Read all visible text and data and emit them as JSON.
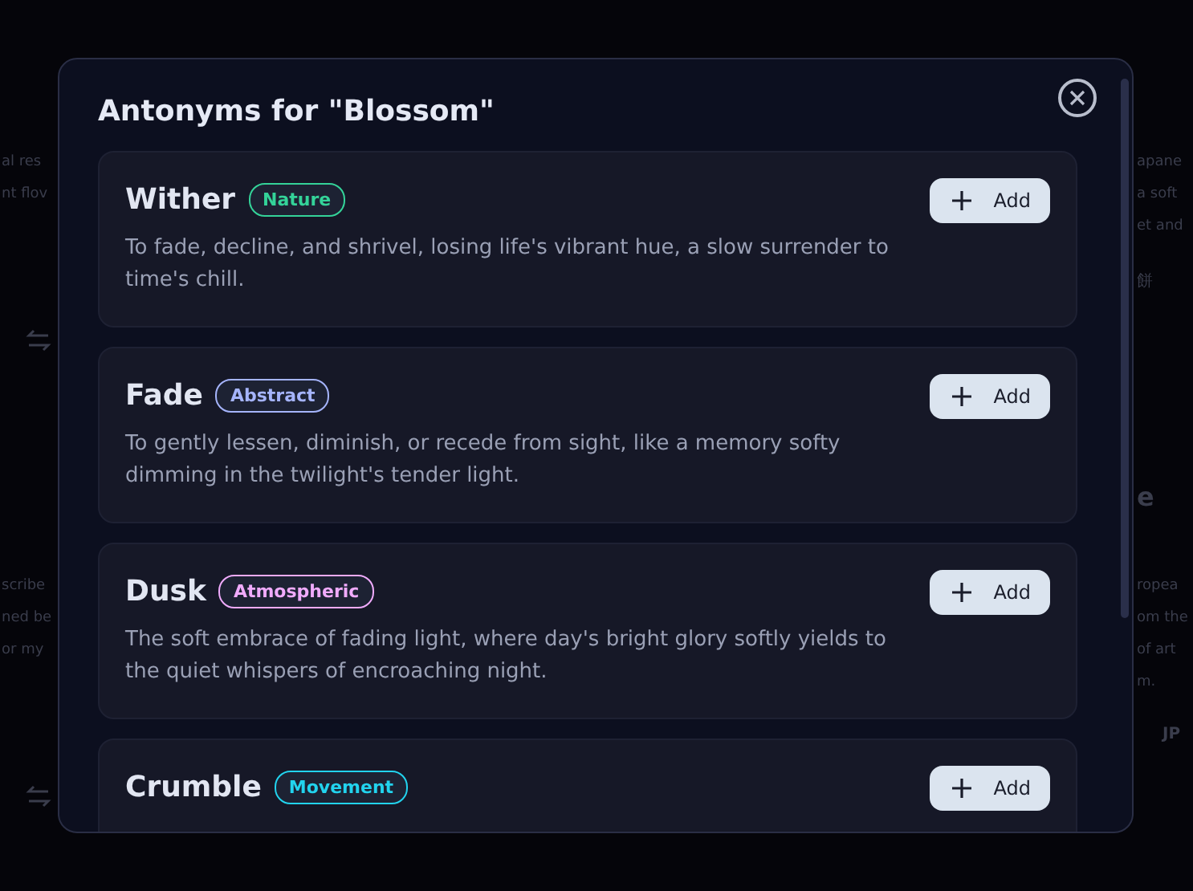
{
  "backdrop": {
    "left": [
      {
        "kind": "text",
        "text": "al res"
      },
      {
        "kind": "text",
        "text": "nt flov"
      },
      {
        "kind": "icon"
      },
      {
        "kind": "text",
        "text": "scribe"
      },
      {
        "kind": "text",
        "text": "ned be"
      },
      {
        "kind": "text",
        "text": "or my"
      },
      {
        "kind": "icon"
      }
    ],
    "right": [
      {
        "kind": "text",
        "text": "apane"
      },
      {
        "kind": "text",
        "text": "a soft"
      },
      {
        "kind": "text",
        "text": "et and"
      },
      {
        "kind": "text",
        "text": "餅"
      },
      {
        "kind": "heading",
        "text": "e"
      },
      {
        "kind": "text",
        "text": "ropea"
      },
      {
        "kind": "text",
        "text": "om the"
      },
      {
        "kind": "text",
        "text": "of art"
      },
      {
        "kind": "text",
        "text": "m."
      },
      {
        "kind": "tag",
        "text": "JP"
      }
    ]
  },
  "modal": {
    "title": "Antonyms for \"Blossom\"",
    "items": [
      {
        "word": "Wither",
        "tag": "Nature",
        "color": "#34d399",
        "description": "To fade, decline, and shrivel, losing life's vibrant hue, a slow surrender to time's chill.",
        "action": "Add"
      },
      {
        "word": "Fade",
        "tag": "Abstract",
        "color": "#a5b4fc",
        "description": "To gently lessen, diminish, or recede from sight, like a memory softy dimming in the twilight's tender light.",
        "action": "Add"
      },
      {
        "word": "Dusk",
        "tag": "Atmospheric",
        "color": "#f0abfc",
        "description": "The soft embrace of fading light, where day's bright glory softly yields to the quiet whispers of encroaching night.",
        "action": "Add"
      },
      {
        "word": "Crumble",
        "tag": "Movement",
        "color": "#22d3ee",
        "action": "Add"
      }
    ]
  }
}
